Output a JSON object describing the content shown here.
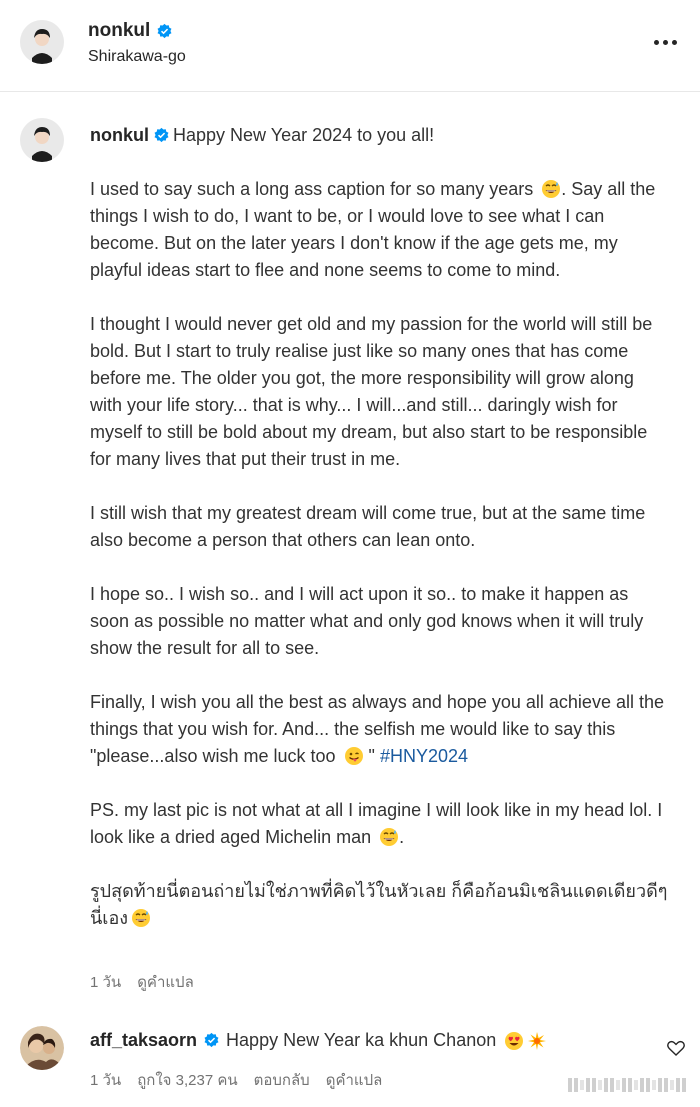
{
  "post": {
    "username": "nonkul",
    "location": "Shirakawa-go"
  },
  "caption": {
    "username": "nonkul",
    "first_line": "Happy New Year 2024 to you all!",
    "paragraphs": [
      "I used to say such a long ass caption for so many years",
      ". Say all the things I wish to do, I want to be, or I would love to see what I can become. But on the later years I don't know if the age gets me, my playful ideas start to flee and none seems to come to mind.",
      "I thought I would never get old and my passion for the world will still be bold. But I start to truly realise just like so many ones that has come before me. The older you got, the more responsibility will grow along with your life story... that is why... I will...and still... daringly wish for myself to still be bold about my dream, but also start to be responsible for many lives that put their trust in me.",
      "I still wish that my greatest dream will come true, but at the same time also become a person that others can lean onto.",
      "I hope so.. I wish so.. and I will act upon it so.. to make it happen as soon as possible no matter what and only god knows when it will truly show the result for all to see.",
      "Finally, I wish you all the best as always and hope you all achieve all the things that you wish for. And... the selfish me would like to say this \"please...also wish me luck too",
      "\"",
      "#HNY2024",
      "PS. my last pic is not what at all I imagine I will look like in my head lol. I look like a dried aged Michelin man",
      ".",
      "รูปสุดท้ายนี่ตอนถ่ายไม่ใช่ภาพที่คิดไว้ในหัวเลย ก็คือก้อนมิเชลินแดดเดียวดีๆนี่เอง"
    ],
    "meta": {
      "time": "1 วัน",
      "translate": "ดูคำแปล"
    }
  },
  "comment": {
    "username": "aff_taksaorn",
    "text": "Happy New Year ka khun Chanon",
    "meta": {
      "time": "1 วัน",
      "likes": "ถูกใจ 3,237 คน",
      "reply": "ตอบกลับ",
      "translate": "ดูคำแปล"
    }
  },
  "icons": {
    "verified": "verified-badge-icon",
    "more": "more-options-icon",
    "heart": "heart-outline-icon",
    "emoji_laugh": "grinning-sweat-emoji",
    "emoji_tongue": "winking-tongue-emoji",
    "emoji_heart_eyes": "heart-eyes-emoji",
    "emoji_sparkle": "sparkle-emoji"
  },
  "colors": {
    "verified_blue": "#0095f6",
    "hashtag": "#1a5a9e",
    "meta_gray": "#737373"
  }
}
